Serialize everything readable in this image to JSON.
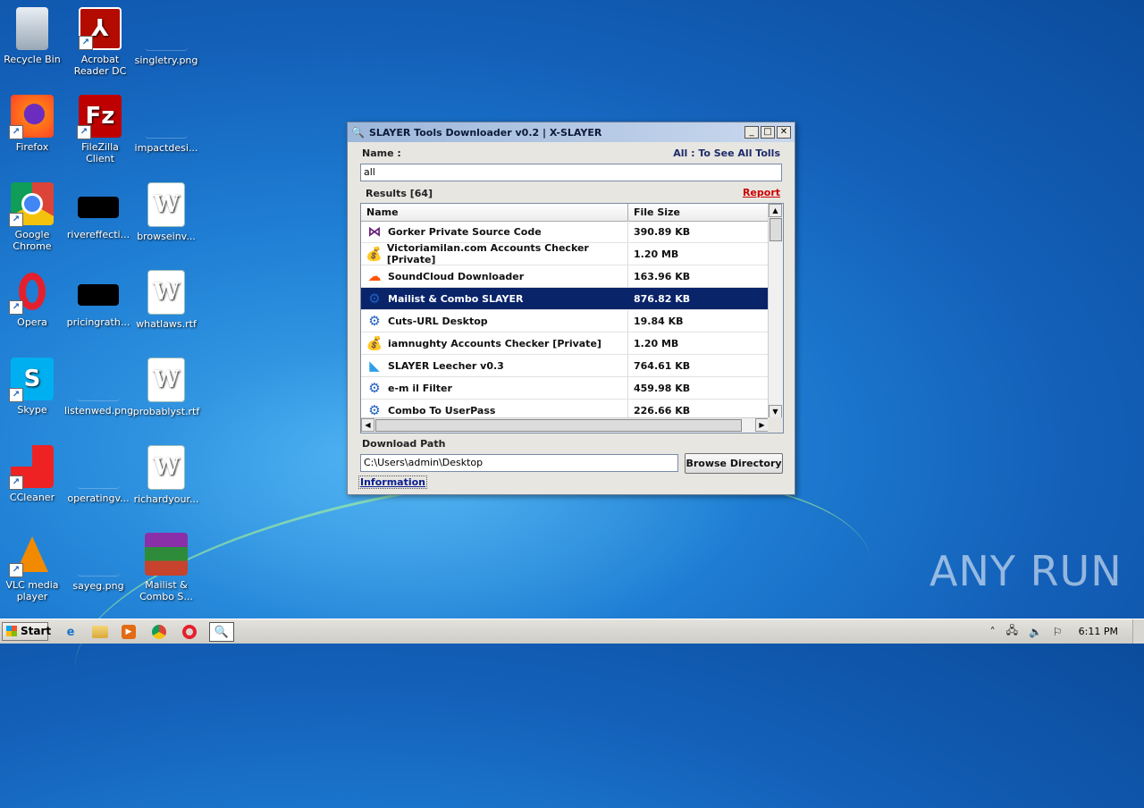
{
  "desktop": {
    "icons": [
      {
        "label": "Recycle Bin",
        "icon": "recycle-bin-icon"
      },
      {
        "label": "Acrobat Reader DC",
        "icon": "acrobat-icon"
      },
      {
        "label": "singletry.png",
        "icon": "image-file-icon"
      },
      {
        "label": "Firefox",
        "icon": "firefox-icon"
      },
      {
        "label": "FileZilla Client",
        "icon": "filezilla-icon"
      },
      {
        "label": "impactdesi...",
        "icon": "image-file-icon"
      },
      {
        "label": "Google Chrome",
        "icon": "chrome-icon"
      },
      {
        "label": "rivereffecti...",
        "icon": "image-file-icon"
      },
      {
        "label": "browseinv...",
        "icon": "word-document-icon"
      },
      {
        "label": "Opera",
        "icon": "opera-icon"
      },
      {
        "label": "pricingrath...",
        "icon": "image-file-icon"
      },
      {
        "label": "whatlaws.rtf",
        "icon": "word-document-icon"
      },
      {
        "label": "Skype",
        "icon": "skype-icon"
      },
      {
        "label": "listenwed.png",
        "icon": "image-file-icon"
      },
      {
        "label": "probablyst.rtf",
        "icon": "word-document-icon"
      },
      {
        "label": "CCleaner",
        "icon": "ccleaner-icon"
      },
      {
        "label": "operatingv...",
        "icon": "image-file-icon"
      },
      {
        "label": "richardyour...",
        "icon": "word-document-icon"
      },
      {
        "label": "VLC media player",
        "icon": "vlc-icon"
      },
      {
        "label": "sayeg.png",
        "icon": "image-file-icon"
      },
      {
        "label": "Mailist & Combo S...",
        "icon": "winrar-archive-icon"
      }
    ]
  },
  "window": {
    "title": "SLAYER Tools Downloader v0.2 | X-SLAYER",
    "title_icon": "search-icon",
    "controls": {
      "minimize": "_",
      "maximize": "□",
      "close": "✕"
    },
    "name_label": "Name :",
    "all_hint": "All : To See All Tolls",
    "search_value": "all",
    "results_label": "Results [64]",
    "report_link": "Report",
    "columns": {
      "name": "Name",
      "size": "File Size"
    },
    "rows": [
      {
        "name": "Gorker Private Source Code",
        "size": "390.89 KB",
        "icon": "visual-studio-icon",
        "glyph": "⋈",
        "color": "#68217a"
      },
      {
        "name": "Victoriamilan.com Accounts Checker [Private]",
        "size": "1.20 MB",
        "icon": "money-bag-icon",
        "glyph": "💰",
        "color": "#c8902a"
      },
      {
        "name": "SoundCloud Downloader",
        "size": "163.96 KB",
        "icon": "soundcloud-icon",
        "glyph": "☁",
        "color": "#ff5500"
      },
      {
        "name": "Mailist & Combo SLAYER",
        "size": "876.82 KB",
        "icon": "gears-icon",
        "glyph": "⚙",
        "color": "#1f5fbf",
        "selected": true
      },
      {
        "name": "Cuts-URL Desktop",
        "size": "19.84 KB",
        "icon": "gears-icon",
        "glyph": "⚙",
        "color": "#1f5fbf"
      },
      {
        "name": "iamnughty Accounts Checker [Private]",
        "size": "1.20 MB",
        "icon": "money-bag-icon",
        "glyph": "💰",
        "color": "#c8902a"
      },
      {
        "name": "SLAYER Leecher v0.3",
        "size": "764.61 KB",
        "icon": "flutter-icon",
        "glyph": "◣",
        "color": "#2d9fe6"
      },
      {
        "name": "e-m il Filter",
        "size": "459.98 KB",
        "icon": "gears-icon",
        "glyph": "⚙",
        "color": "#1f5fbf"
      },
      {
        "name": "Combo To UserPass",
        "size": "226.66 KB",
        "icon": "gears-icon",
        "glyph": "⚙",
        "color": "#1f5fbf"
      }
    ],
    "download_path_label": "Download Path",
    "download_path_value": "C:\\Users\\admin\\Desktop",
    "browse_button": "Browse Directory",
    "information_link": "Information"
  },
  "taskbar": {
    "start_label": "Start",
    "pinned": [
      "internet-explorer-icon",
      "folder-icon",
      "media-player-icon",
      "chrome-icon",
      "opera-icon",
      "search-icon"
    ],
    "clock": "6:11 PM"
  },
  "watermark": "ANY RUN"
}
